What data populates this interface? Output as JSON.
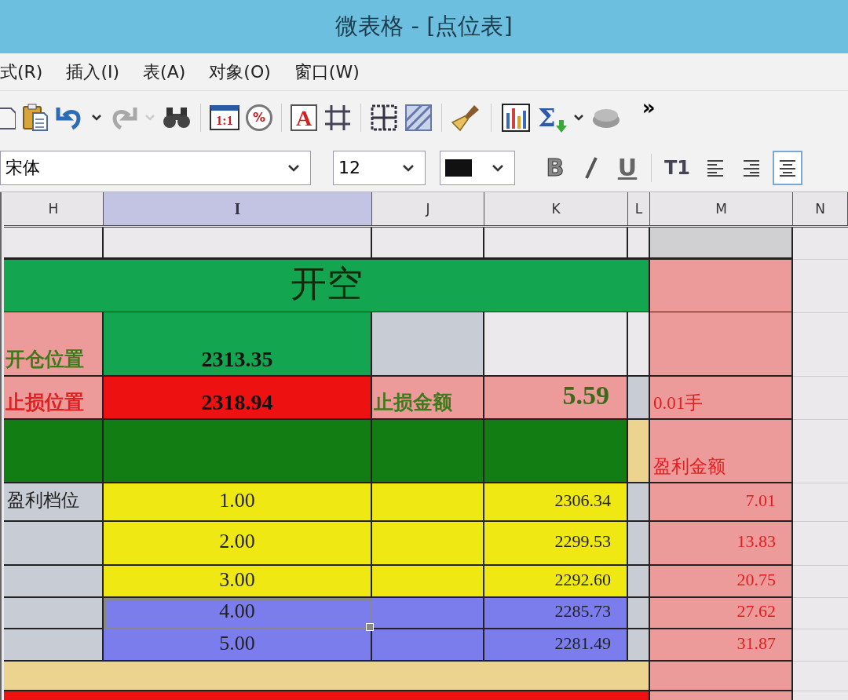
{
  "window": {
    "title": "微表格 - [点位表]"
  },
  "menu": [
    "式(R)",
    "插入(I)",
    "表(A)",
    "对象(O)",
    "窗口(W)"
  ],
  "toolbar": [
    {
      "kind": "doc",
      "disabled": false
    },
    {
      "kind": "paste",
      "disabled": false
    },
    {
      "kind": "undo",
      "disabled": false
    },
    {
      "kind": "caret",
      "disabled": false
    },
    {
      "kind": "redo",
      "disabled": true
    },
    {
      "kind": "caret",
      "disabled": true
    },
    {
      "kind": "find",
      "disabled": false
    },
    {
      "kind": "sep"
    },
    {
      "kind": "zoom",
      "glyph": "1:1",
      "disabled": false
    },
    {
      "kind": "percent",
      "glyph": "%",
      "disabled": false
    },
    {
      "kind": "sep"
    },
    {
      "kind": "font",
      "glyph": "A",
      "disabled": false
    },
    {
      "kind": "crop",
      "disabled": false
    },
    {
      "kind": "sep"
    },
    {
      "kind": "grid",
      "disabled": false
    },
    {
      "kind": "hatch",
      "disabled": false
    },
    {
      "kind": "sep"
    },
    {
      "kind": "brush",
      "disabled": false
    },
    {
      "kind": "sep"
    },
    {
      "kind": "chart",
      "disabled": false
    },
    {
      "kind": "sum",
      "glyph": "Σ",
      "disabled": false
    },
    {
      "kind": "caret",
      "disabled": false
    },
    {
      "kind": "shape",
      "disabled": false
    },
    {
      "kind": "more",
      "glyph": "»",
      "disabled": false
    }
  ],
  "format": {
    "font": "宋体",
    "size": "12",
    "buttons": [
      {
        "kind": "bold",
        "glyph": "B",
        "selected": false
      },
      {
        "kind": "italic",
        "selected": false
      },
      {
        "kind": "underline",
        "glyph": "U",
        "selected": false
      },
      {
        "kind": "sep"
      },
      {
        "kind": "direction",
        "glyph": "T1",
        "selected": false
      },
      {
        "kind": "left",
        "selected": false
      },
      {
        "kind": "right",
        "selected": false
      },
      {
        "kind": "center",
        "selected": true
      }
    ]
  },
  "columns": [
    {
      "label": "H",
      "selected": false
    },
    {
      "label": "I",
      "selected": true
    },
    {
      "label": "J",
      "selected": false
    },
    {
      "label": "K",
      "selected": false
    },
    {
      "label": "L",
      "selected": false
    },
    {
      "label": "M",
      "selected": false
    },
    {
      "label": "N",
      "selected": false
    }
  ],
  "rows": [
    {
      "kind": "plain",
      "cells": [
        {
          "color": "#ebe9ec",
          "selected": false
        },
        {
          "color": "#ebe9ec",
          "selected": false
        },
        {
          "color": "#ebe9ec",
          "selected": false
        },
        {
          "color": "#ebe9ec",
          "selected": false
        },
        {
          "color": "#ebe9ec",
          "selected": false
        },
        {
          "color": "#d0cfd2",
          "selected": false
        }
      ]
    },
    {
      "kind": "merged",
      "cells": [
        {
          "color": "#14a550",
          "text": "开空",
          "kind": "title",
          "selected": false
        },
        {
          "color": "#ec9a9a",
          "selected": false
        }
      ]
    },
    {
      "kind": "plain",
      "cells": [
        {
          "color": "#ec9a9a",
          "text": "开仓位置",
          "kind": "label-open",
          "selected": false
        },
        {
          "color": "#14a550",
          "text": "2313.35",
          "kind": "price",
          "selected": false
        },
        {
          "color": "#c8ccd4",
          "selected": false
        },
        {
          "color": "#ebe9ec",
          "selected": false
        },
        {
          "color": "#ebe9ec",
          "selected": false
        },
        {
          "color": "#ec9a9a",
          "selected": false
        }
      ]
    },
    {
      "kind": "plain",
      "cells": [
        {
          "color": "#ec9a9a",
          "text": "止损位置",
          "kind": "label-stop",
          "selected": false
        },
        {
          "color": "#ee1111",
          "text": "2318.94",
          "kind": "price",
          "selected": false
        },
        {
          "color": "#ec9a9a",
          "text": "止损金额",
          "kind": "label-open",
          "selected": false
        },
        {
          "color": "#ec9a9a",
          "text": "5.59",
          "kind": "amount",
          "selected": false
        },
        {
          "color": "#c8ccd4",
          "selected": false
        },
        {
          "color": "#ec9a9a",
          "text": "0.01手",
          "kind": "note",
          "selected": false
        }
      ]
    },
    {
      "kind": "plain",
      "cells": [
        {
          "color": "#127d12",
          "selected": false
        },
        {
          "color": "#127d12",
          "selected": false
        },
        {
          "color": "#127d12",
          "selected": false
        },
        {
          "color": "#127d12",
          "selected": false
        },
        {
          "color": "#ecd48f",
          "selected": false
        },
        {
          "color": "#ec9a9a",
          "text": "盈利金额",
          "kind": "note",
          "selected": false
        }
      ]
    },
    {
      "kind": "plain",
      "cells": [
        {
          "color": "#c8ccd4",
          "text": "盈利档位",
          "kind": "caption",
          "selected": false
        },
        {
          "color": "#efe812",
          "text": "1.00",
          "kind": "step",
          "selected": false
        },
        {
          "color": "#efe812",
          "selected": false
        },
        {
          "color": "#efe812",
          "text": "2306.34",
          "kind": "number",
          "selected": false
        },
        {
          "color": "#c8ccd4",
          "selected": false
        },
        {
          "color": "#ec9a9a",
          "text": "7.01",
          "kind": "profit",
          "selected": false
        }
      ]
    },
    {
      "kind": "plain",
      "cells": [
        {
          "color": "#c8ccd4",
          "selected": false
        },
        {
          "color": "#efe812",
          "text": "2.00",
          "kind": "step",
          "selected": false
        },
        {
          "color": "#efe812",
          "selected": false
        },
        {
          "color": "#efe812",
          "text": "2299.53",
          "kind": "number",
          "selected": false
        },
        {
          "color": "#c8ccd4",
          "selected": false
        },
        {
          "color": "#ec9a9a",
          "text": "13.83",
          "kind": "profit",
          "selected": false
        }
      ]
    },
    {
      "kind": "plain",
      "cells": [
        {
          "color": "#c8ccd4",
          "selected": false
        },
        {
          "color": "#efe812",
          "text": "3.00",
          "kind": "step",
          "selected": false
        },
        {
          "color": "#efe812",
          "selected": false
        },
        {
          "color": "#efe812",
          "text": "2292.60",
          "kind": "number",
          "selected": false
        },
        {
          "color": "#c8ccd4",
          "selected": false
        },
        {
          "color": "#ec9a9a",
          "text": "20.75",
          "kind": "profit",
          "selected": false
        }
      ]
    },
    {
      "kind": "plain",
      "cells": [
        {
          "color": "#c8ccd4",
          "selected": false
        },
        {
          "color": "#7b7ded",
          "text": "4.00",
          "kind": "step",
          "selected": true
        },
        {
          "color": "#7b7ded",
          "selected": false
        },
        {
          "color": "#7b7ded",
          "text": "2285.73",
          "kind": "number",
          "selected": false
        },
        {
          "color": "#c8ccd4",
          "selected": false
        },
        {
          "color": "#ec9a9a",
          "text": "27.62",
          "kind": "profit",
          "selected": false
        }
      ]
    },
    {
      "kind": "plain",
      "cells": [
        {
          "color": "#c8ccd4",
          "selected": false
        },
        {
          "color": "#7b7ded",
          "text": "5.00",
          "kind": "step",
          "selected": false
        },
        {
          "color": "#7b7ded",
          "selected": false
        },
        {
          "color": "#7b7ded",
          "text": "2281.49",
          "kind": "number",
          "selected": false
        },
        {
          "color": "#c8ccd4",
          "selected": false
        },
        {
          "color": "#ec9a9a",
          "text": "31.87",
          "kind": "profit",
          "selected": false
        }
      ]
    },
    {
      "kind": "merged",
      "cells": [
        {
          "color": "#ecd48f",
          "selected": false
        },
        {
          "color": "#ec9a9a",
          "selected": false
        }
      ]
    },
    {
      "kind": "merged",
      "cells": [
        {
          "color": "#ee1111",
          "selected": false
        },
        {
          "color": "#ec9a9a",
          "selected": false
        }
      ]
    }
  ]
}
